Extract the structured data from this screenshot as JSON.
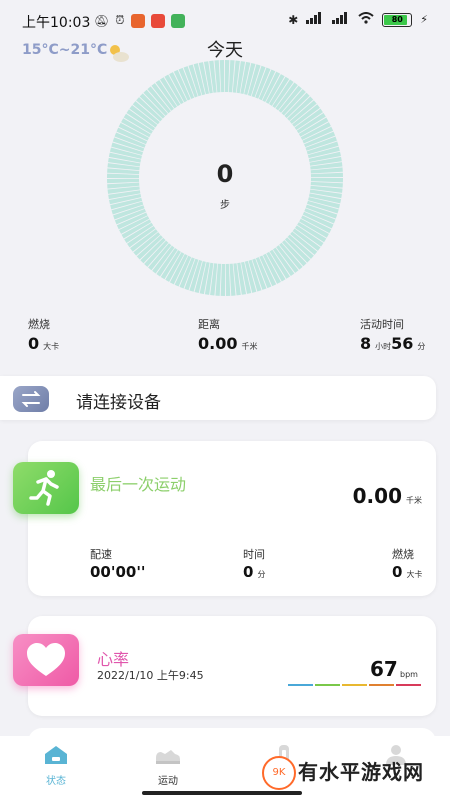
{
  "status_bar": {
    "time": "上午10:03",
    "battery": "80"
  },
  "header": {
    "weather": "15°C~21°C",
    "title": "今天"
  },
  "steps": {
    "value": "0",
    "unit": "步"
  },
  "stats": [
    {
      "label": "燃烧",
      "value": "0",
      "unit": "大卡"
    },
    {
      "label": "距离",
      "value": "0.00",
      "unit": "千米"
    },
    {
      "label": "活动时间",
      "value": "8",
      "unit": "小时",
      "value2": "56",
      "unit2": "分"
    }
  ],
  "connect": {
    "label": "请连接设备"
  },
  "exercise": {
    "title": "最后一次运动",
    "distance": "0.00",
    "distance_unit": "千米",
    "metrics": [
      {
        "label": "配速",
        "value": "00'00''",
        "unit": ""
      },
      {
        "label": "时间",
        "value": "0",
        "unit": "分"
      },
      {
        "label": "燃烧",
        "value": "0",
        "unit": "大卡"
      }
    ]
  },
  "heart_rate": {
    "title": "心率",
    "date": "2022/1/10 上午9:45",
    "value": "67",
    "unit": "bpm",
    "zone_colors": [
      "#4aa8d8",
      "#7ac84a",
      "#e8b830",
      "#e08030",
      "#d83a5a"
    ]
  },
  "tabs": [
    {
      "label": "状态",
      "icon": "house-icon",
      "active": true
    },
    {
      "label": "运动",
      "icon": "sneaker-icon",
      "active": false
    },
    {
      "label": "",
      "icon": "watch-icon",
      "active": false
    },
    {
      "label": "",
      "icon": "person-icon",
      "active": false
    }
  ],
  "watermark": {
    "badge": "9K",
    "text": "有水平游戏网"
  },
  "colors": {
    "ring": "#bfe6df",
    "active_tab": "#59b4d4",
    "exercise_green": "#8ccf6b",
    "heart_pink": "#e056ac"
  }
}
